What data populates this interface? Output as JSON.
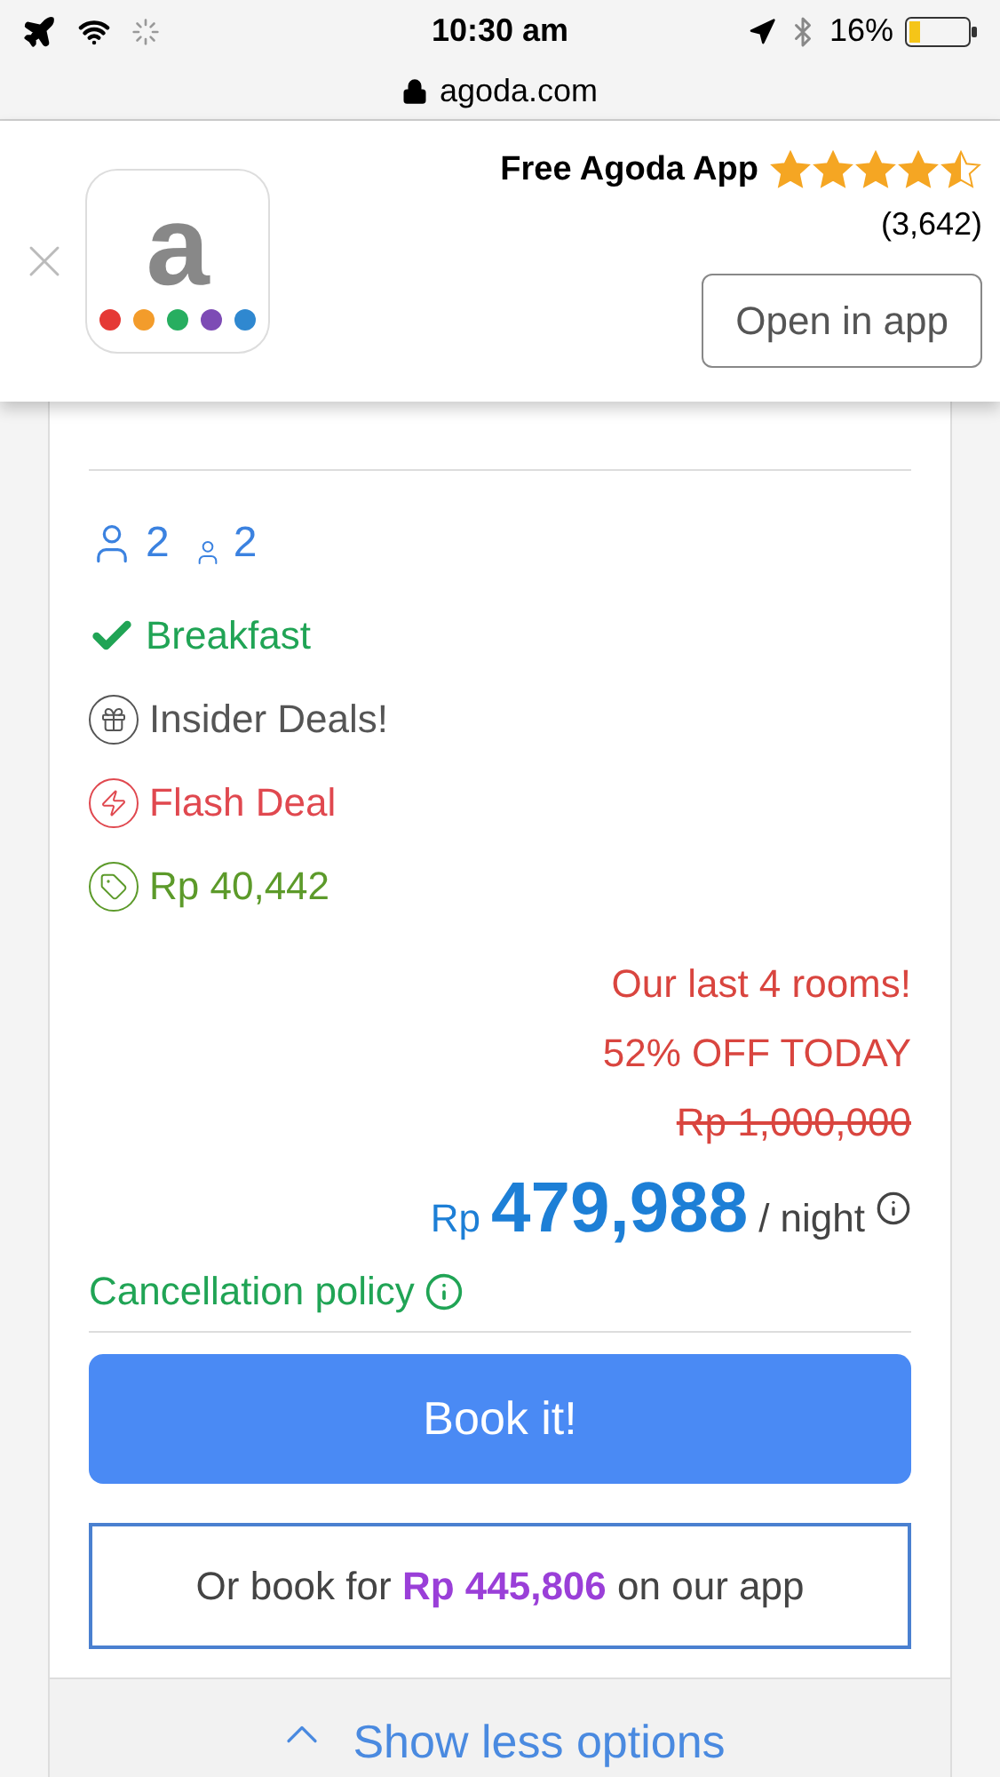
{
  "status_bar": {
    "time": "10:30 am",
    "battery": "16%"
  },
  "address_bar": {
    "domain": "agoda.com"
  },
  "app_banner": {
    "logo_letter": "a",
    "title": "Free Agoda App",
    "stars": 4.5,
    "reviews": "(3,642)",
    "button": "Open in app"
  },
  "occupancy": [
    {
      "kind": "adult",
      "count": "2"
    },
    {
      "kind": "child",
      "count": "2"
    }
  ],
  "benefits": [
    {
      "kind": "check",
      "label": "Breakfast"
    },
    {
      "kind": "gift",
      "label": "Insider Deals!"
    },
    {
      "kind": "flash",
      "label": "Flash Deal"
    },
    {
      "kind": "tag",
      "label": "Rp 40,442"
    }
  ],
  "urgency": [
    "Our last 4 rooms!",
    "52% OFF TODAY"
  ],
  "original_price": "Rp 1,000,000",
  "price": {
    "currency": "Rp",
    "amount": "479,988",
    "unit": "/ night"
  },
  "cancellation": "Cancellation policy",
  "book_button": "Book it!",
  "app_offer": "Or book for **Rp 445,806** on our app",
  "show_less": "Show less options"
}
